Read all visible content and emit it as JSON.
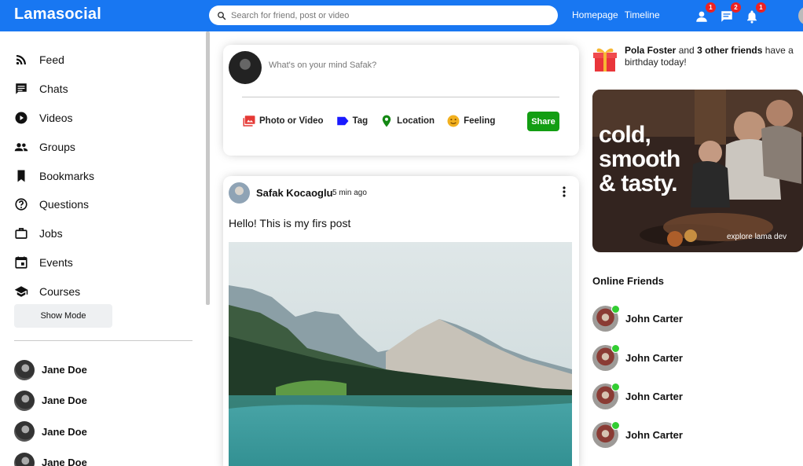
{
  "app": {
    "logo": "Lamasocial"
  },
  "topbar": {
    "search_placeholder": "Search for friend, post or video",
    "links": [
      "Homepage",
      "Timeline"
    ],
    "icons": [
      {
        "name": "person-icon",
        "badge": "1"
      },
      {
        "name": "chat-icon",
        "badge": "2"
      },
      {
        "name": "bell-icon",
        "badge": "1"
      }
    ]
  },
  "sidebar": {
    "items": [
      {
        "label": "Feed",
        "icon": "rss-icon"
      },
      {
        "label": "Chats",
        "icon": "chat-icon"
      },
      {
        "label": "Videos",
        "icon": "play-circle-icon"
      },
      {
        "label": "Groups",
        "icon": "group-icon"
      },
      {
        "label": "Bookmarks",
        "icon": "bookmark-icon"
      },
      {
        "label": "Questions",
        "icon": "help-circle-icon"
      },
      {
        "label": "Jobs",
        "icon": "briefcase-icon"
      },
      {
        "label": "Events",
        "icon": "calendar-icon"
      },
      {
        "label": "Courses",
        "icon": "school-icon"
      }
    ],
    "show_more_label": "Show Mode",
    "friends": [
      "Jane Doe",
      "Jane Doe",
      "Jane Doe",
      "Jane Doe"
    ]
  },
  "share": {
    "placeholder": "What's on your mind Safak?",
    "options": [
      {
        "label": "Photo or Video",
        "icon": "photo-icon",
        "color": "#e53935"
      },
      {
        "label": "Tag",
        "icon": "label-icon",
        "color": "#1a1aff"
      },
      {
        "label": "Location",
        "icon": "location-icon",
        "color": "#138813"
      },
      {
        "label": "Feeling",
        "icon": "emoji-icon",
        "color": "#f2b01e"
      }
    ],
    "button_label": "Share",
    "button_color": "#139e13"
  },
  "post": {
    "username": "Safak Kocaoglu",
    "time": "5 min ago",
    "text": "Hello! This is my firs post"
  },
  "rightbar": {
    "birthday": {
      "name": "Pola Foster",
      "mid": " and ",
      "others": "3 other friends",
      "rest": " have a birthday today!"
    },
    "ad": {
      "lines": [
        "cold,",
        "smooth",
        "& tasty."
      ],
      "footer": "explore lama dev"
    },
    "online_title": "Online Friends",
    "online_friends": [
      "John Carter",
      "John Carter",
      "John Carter",
      "John Carter"
    ]
  },
  "colors": {
    "brand": "#1877f2",
    "online": "#32cd32",
    "badge": "#ee2222"
  }
}
